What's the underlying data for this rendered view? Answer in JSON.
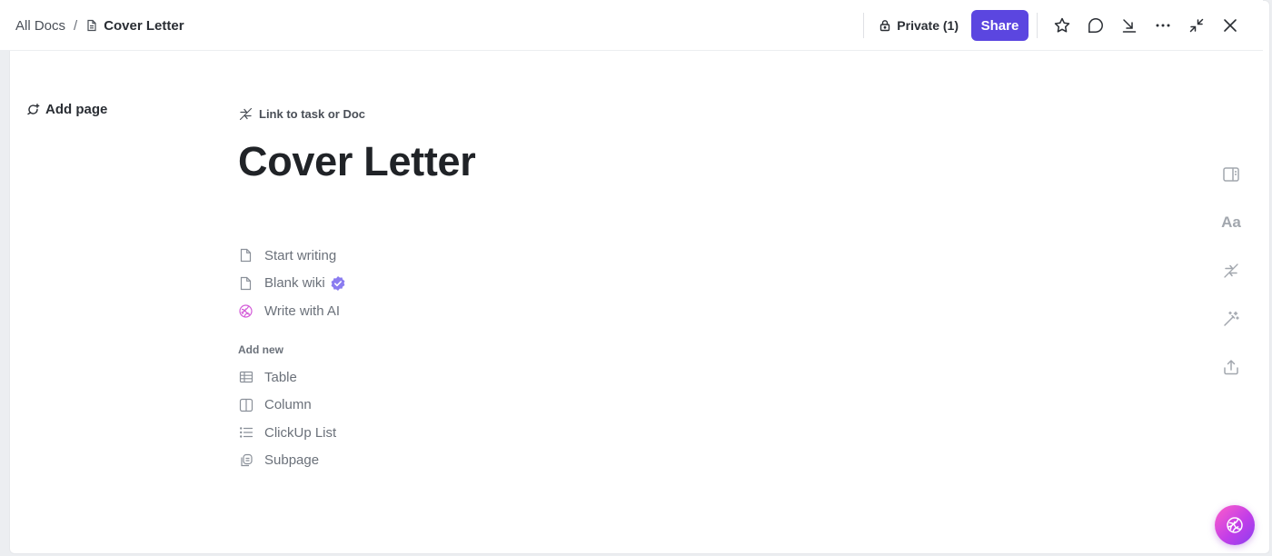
{
  "breadcrumb": {
    "root": "All Docs",
    "separator": "/",
    "current": "Cover Letter"
  },
  "header": {
    "private_label": "Private (1)",
    "share_label": "Share",
    "icons": [
      "star-icon",
      "comment-icon",
      "collapse-arrow-icon",
      "more-icon",
      "minimize-icon",
      "close-icon"
    ]
  },
  "sidebar": {
    "add_page_label": "Add page"
  },
  "doc": {
    "link_label": "Link to task or Doc",
    "title": "Cover Letter",
    "start_options": [
      {
        "label": "Start writing",
        "icon": "page-icon"
      },
      {
        "label": "Blank wiki",
        "icon": "page-icon",
        "badge": "verified-badge-icon"
      },
      {
        "label": "Write with AI",
        "icon": "ai-brain-icon"
      }
    ],
    "add_new_label": "Add new",
    "add_new_options": [
      {
        "label": "Table",
        "icon": "table-icon"
      },
      {
        "label": "Column",
        "icon": "column-icon"
      },
      {
        "label": "ClickUp List",
        "icon": "list-icon"
      },
      {
        "label": "Subpage",
        "icon": "subpage-icon"
      }
    ]
  },
  "right_rail": {
    "font_label": "Aa",
    "icons": [
      "sidebar-panel-icon",
      "font-icon",
      "relationship-icon",
      "magic-wand-icon",
      "export-icon"
    ]
  },
  "colors": {
    "accent": "#5b46e0",
    "verified_badge": "#8b7cf0",
    "ai_gradient_start": "#ff5ec8",
    "ai_gradient_end": "#8a3df0"
  }
}
